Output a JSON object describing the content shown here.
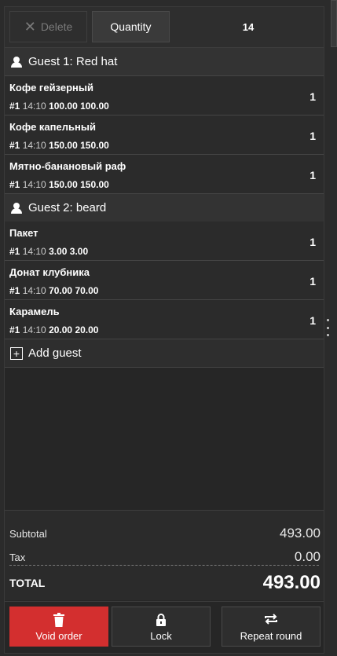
{
  "toolbar": {
    "delete_label": "Delete",
    "quantity_label": "Quantity",
    "quantity_value": "14"
  },
  "guests": [
    {
      "label": "Guest 1: Red hat",
      "items": [
        {
          "name": "Кофе гейзерный",
          "round": "#1",
          "time": "14:10",
          "price": "100.00",
          "total": "100.00",
          "qty": "1"
        },
        {
          "name": "Кофе капельный",
          "round": "#1",
          "time": "14:10",
          "price": "150.00",
          "total": "150.00",
          "qty": "1"
        },
        {
          "name": "Мятно-банановый раф",
          "round": "#1",
          "time": "14:10",
          "price": "150.00",
          "total": "150.00",
          "qty": "1"
        }
      ]
    },
    {
      "label": "Guest 2: beard",
      "items": [
        {
          "name": "Пакет",
          "round": "#1",
          "time": "14:10",
          "price": "3.00",
          "total": "3.00",
          "qty": "1"
        },
        {
          "name": "Донат клубника",
          "round": "#1",
          "time": "14:10",
          "price": "70.00",
          "total": "70.00",
          "qty": "1"
        },
        {
          "name": "Карамель",
          "round": "#1",
          "time": "14:10",
          "price": "20.00",
          "total": "20.00",
          "qty": "1"
        }
      ]
    }
  ],
  "add_guest_label": "Add guest",
  "totals": {
    "subtotal_label": "Subtotal",
    "subtotal_value": "493.00",
    "tax_label": "Tax",
    "tax_value": "0.00",
    "total_label": "TOTAL",
    "total_value": "493.00"
  },
  "actions": {
    "void_label": "Void order",
    "lock_label": "Lock",
    "repeat_label": "Repeat round"
  },
  "colors": {
    "void_button": "#d32f2f",
    "background": "#262626"
  }
}
